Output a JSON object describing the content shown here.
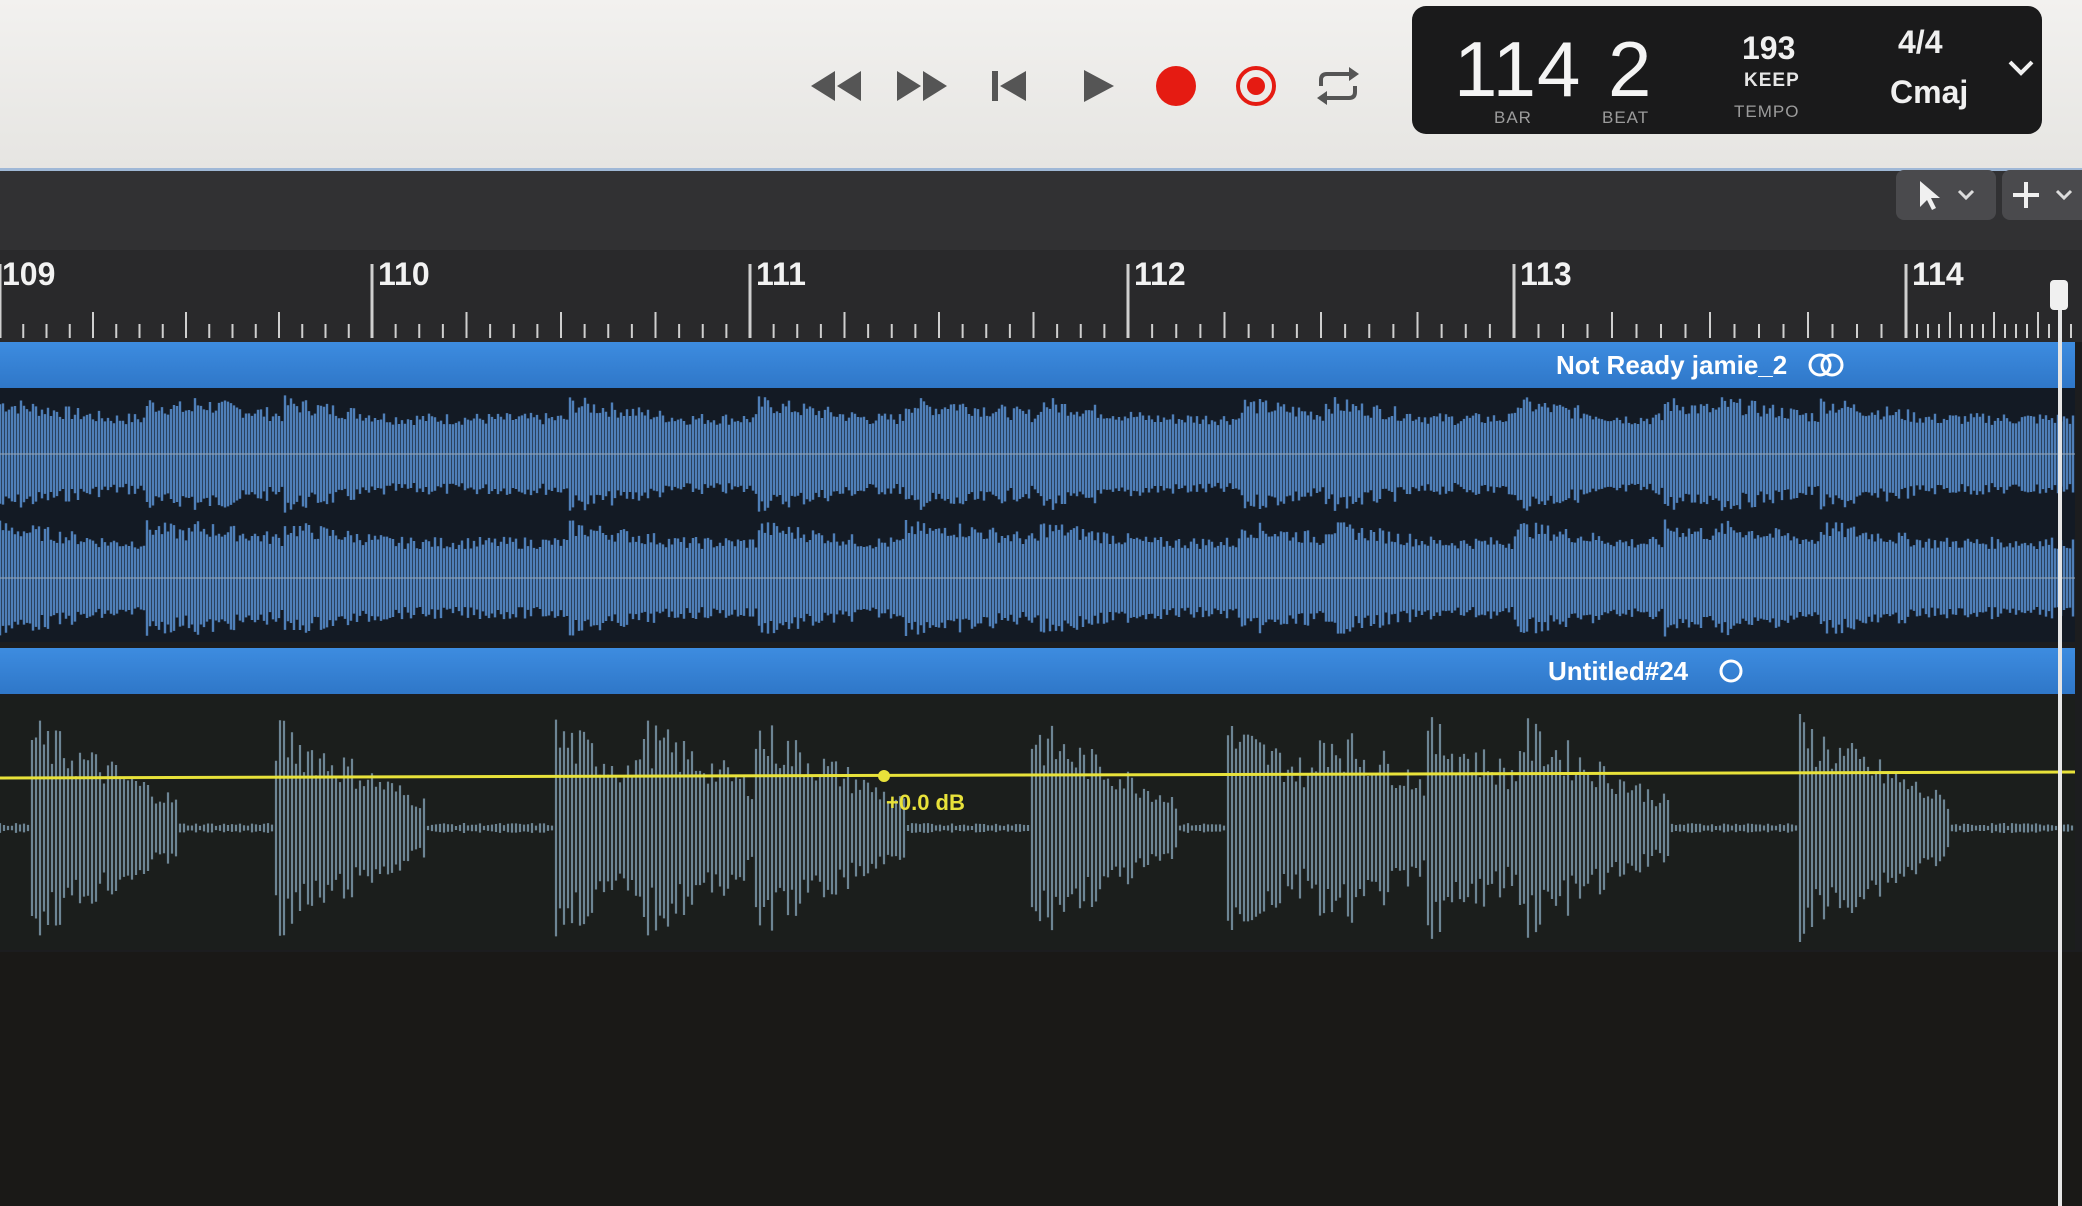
{
  "transport": {
    "buttons": [
      "rewind",
      "fast-forward",
      "go-to-beginning",
      "play",
      "record",
      "capture-recording",
      "cycle"
    ],
    "record_color": "#e51b12"
  },
  "lcd": {
    "bar": "114",
    "beat": "2",
    "bar_label": "BAR",
    "beat_label": "BEAT",
    "tempo": "193",
    "tempo_mode": "KEEP",
    "tempo_label": "TEMPO",
    "time_signature": "4/4",
    "key": "Cmaj"
  },
  "toolbar": {
    "pointer_tool_icon": "pointer-icon",
    "pencil_tool_icon": "crosshair-icon"
  },
  "ruler": {
    "bars": [
      "109",
      "110",
      "111",
      "112",
      "113",
      "114"
    ]
  },
  "regions": [
    {
      "name": "Not Ready jamie_2",
      "color": "#3d8ce0",
      "icon": "stereo-icon"
    },
    {
      "name": "Untitled#24",
      "color": "#3d8ce0",
      "icon": "mono-icon"
    }
  ],
  "automation": {
    "volume_label": "+0.0 dB",
    "line_color": "#e8e23a"
  }
}
